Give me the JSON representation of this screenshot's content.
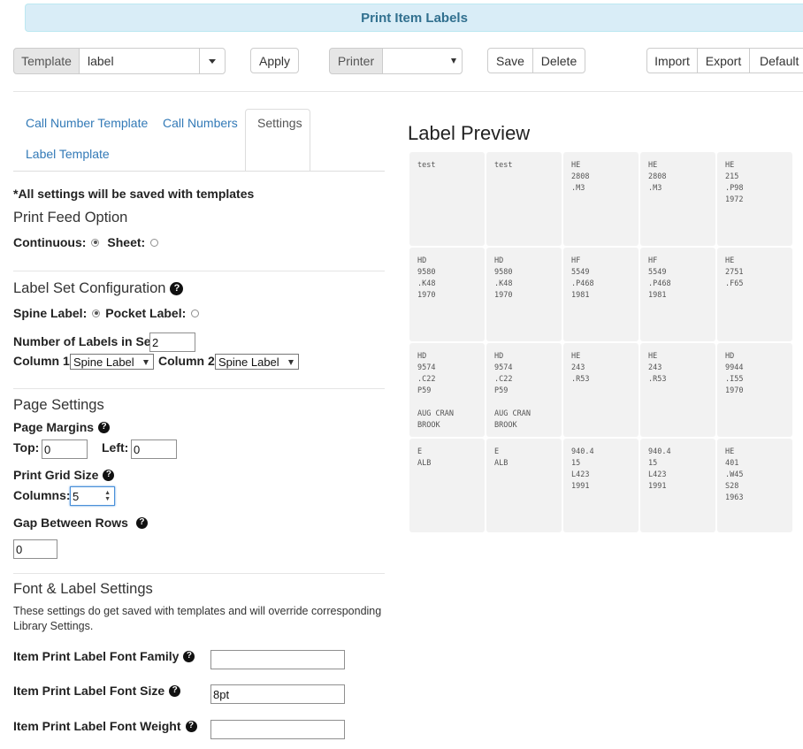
{
  "header": {
    "title": "Print Item Labels"
  },
  "toolbar": {
    "template_label": "Template",
    "template_value": "label",
    "apply": "Apply",
    "printer_label": "Printer",
    "printer_value": "",
    "save": "Save",
    "delete": "Delete",
    "import": "Import",
    "export": "Export",
    "default": "Default"
  },
  "tabs": [
    "Call Number Template",
    "Call Numbers",
    "Settings",
    "Label Template"
  ],
  "settings": {
    "note": "*All settings will be saved with templates",
    "print_feed": {
      "heading": "Print Feed Option",
      "continuous": "Continuous:",
      "sheet": "Sheet:",
      "selected": "continuous"
    },
    "label_set": {
      "heading": "Label Set Configuration",
      "spine": "Spine Label:",
      "pocket": "Pocket Label:",
      "selected": "spine",
      "num_labels_label": "Number of Labels in Set:",
      "num_labels_value": "2",
      "column1_label": "Column 1",
      "column1_value": "Spine Label",
      "column2_label": "Column 2",
      "column2_value": "Spine Label"
    },
    "page": {
      "heading": "Page Settings",
      "margins_label": "Page Margins",
      "top_label": "Top:",
      "top_value": "0",
      "left_label": "Left:",
      "left_value": "0",
      "grid_label": "Print Grid Size",
      "columns_label": "Columns:",
      "columns_value": "5",
      "gap_label": "Gap Between Rows",
      "gap_value": "0"
    },
    "font": {
      "heading": "Font & Label Settings",
      "desc": "These settings do get saved with templates and will override corresponding Library Settings.",
      "family_label": "Item Print Label Font Family",
      "family_value": "",
      "size_label": "Item Print Label Font Size",
      "size_value": "8pt",
      "weight_label": "Item Print Label Font Weight",
      "weight_value": ""
    }
  },
  "preview": {
    "heading": "Label Preview",
    "rows": [
      [
        "test",
        "test",
        "HE\n2808\n.M3",
        "HE\n2808\n.M3",
        "HE\n215\n.P98\n1972"
      ],
      [
        "HD\n9580\n.K48\n1970",
        "HD\n9580\n.K48\n1970",
        "HF\n5549\n.P468\n1981",
        "HF\n5549\n.P468\n1981",
        "HE\n2751\n.F65"
      ],
      [
        "HD\n9574\n.C22\nP59\n\nAUG CRAN\nBROOK",
        "HD\n9574\n.C22\nP59\n\nAUG CRAN\nBROOK",
        "HE\n243\n.R53",
        "HE\n243\n.R53",
        "HD\n9944\n.I55\n1970"
      ],
      [
        "E\nALB",
        "E\nALB",
        "940.4\n15\nL423\n1991",
        "940.4\n15\nL423\n1991",
        "HE\n401\n.W45\nS28\n1963"
      ]
    ]
  },
  "colors": {
    "title_bg": "#d9edf7",
    "title_text": "#31708f",
    "link": "#337ab7",
    "cell_bg": "#f2f2f2"
  }
}
